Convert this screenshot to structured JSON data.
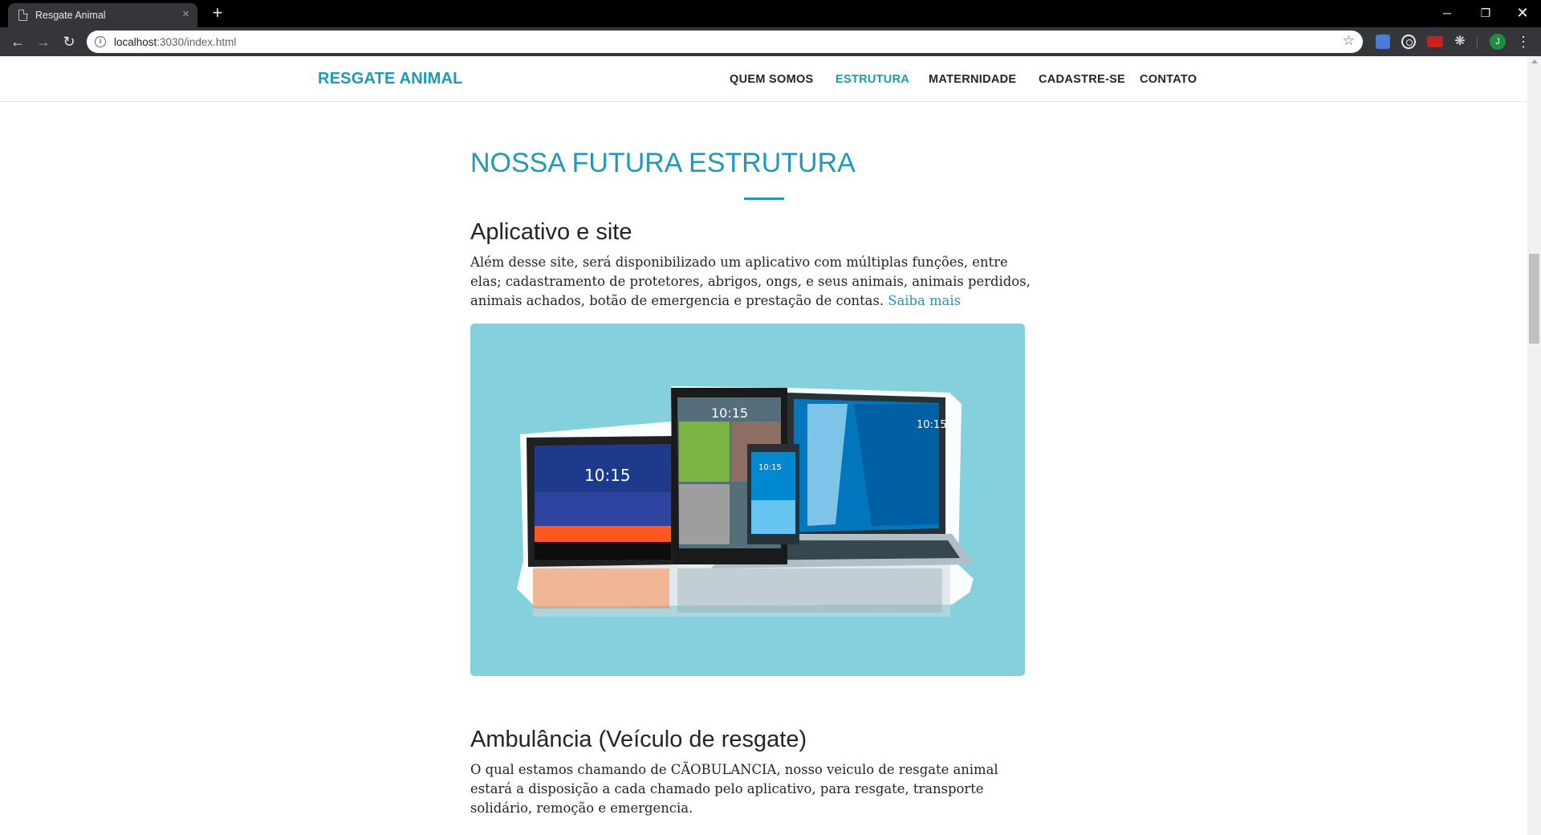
{
  "browser": {
    "tab_title": "Resgate Animal",
    "tab_close": "×",
    "new_tab": "+",
    "url_host": "localhost",
    "url_rest": ":3030/index.html",
    "window_controls": {
      "minimize": "─",
      "maximize": "❐",
      "close": "✕"
    },
    "profile_initial": "J"
  },
  "site": {
    "brand": "RESGATE ANIMAL",
    "nav": [
      {
        "label": "QUEM SOMOS",
        "active": false
      },
      {
        "label": "ESTRUTURA",
        "active": true
      },
      {
        "label": "MATERNIDADE",
        "active": false
      },
      {
        "label": "CADASTRE-SE",
        "active": false
      },
      {
        "label": "CONTATO",
        "active": false
      }
    ],
    "accent_color": "#1f99b5"
  },
  "main": {
    "section_title": "NOSSA FUTURA ESTRUTURA",
    "app_block": {
      "heading": "Aplicativo e site",
      "text": "Além desse site, será disponibilizado um aplicativo com múltiplas funções, entre elas; cadastramento de protetores, abrigos, ongs, e seus animais, animais perdidos, animais achados, botão de emergencia e prestação de contas.",
      "link": "Saiba mais",
      "image_bg_color": "#84d0dc",
      "image_device_screen_text": [
        "10:15",
        "10:15",
        "10:15",
        "10:15"
      ]
    },
    "ambulance_block": {
      "heading": "Ambulância (Veículo de resgate)",
      "text": "O qual estamos chamando de CÃOBULANCIA, nosso veiculo de resgate animal estará a disposição a cada chamado pelo aplicativo, para resgate, transporte solidário, remoção e emergencia."
    }
  }
}
